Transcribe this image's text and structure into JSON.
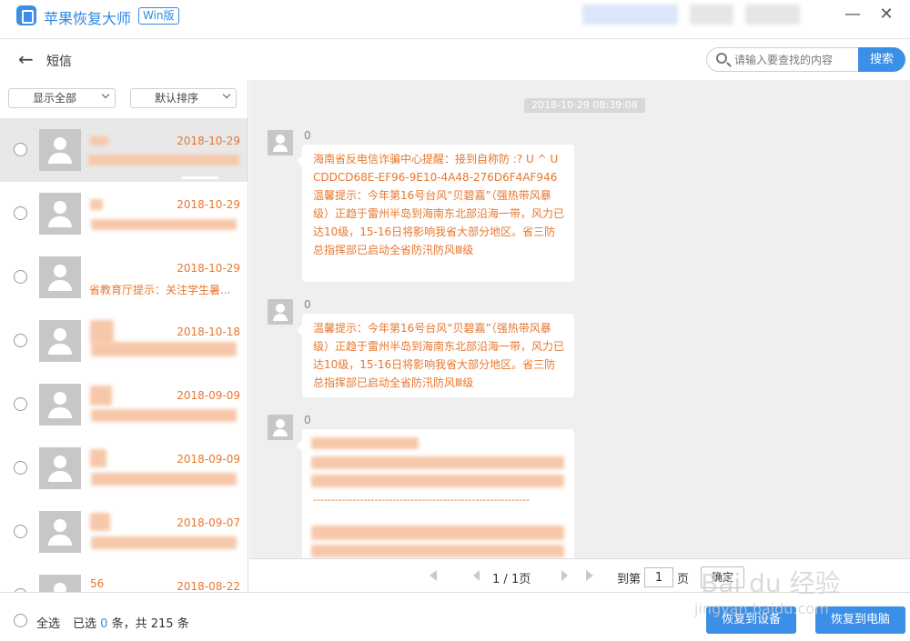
{
  "app": {
    "title": "苹果恢复大师",
    "edition_badge": "Win版"
  },
  "window": {
    "minimize_icon": "minimize-icon",
    "close_icon": "close-icon"
  },
  "nav": {
    "back_icon": "arrow-left-icon",
    "title": "短信"
  },
  "search": {
    "placeholder": "请输入要查找的内容",
    "value": "",
    "button_label": "搜索"
  },
  "filters": {
    "show": "显示全部",
    "sort": "默认排序"
  },
  "conversations": [
    {
      "name": "",
      "date": "2018-10-29",
      "preview": "",
      "selected": true
    },
    {
      "name": "",
      "date": "2018-10-29",
      "preview": "",
      "selected": false
    },
    {
      "name": "",
      "date": "2018-10-29",
      "preview": "省教育厅提示：关注学生暑...",
      "selected": false
    },
    {
      "name": "",
      "date": "2018-10-18",
      "preview": "",
      "selected": false
    },
    {
      "name": "",
      "date": "2018-09-09",
      "preview": "",
      "selected": false
    },
    {
      "name": "",
      "date": "2018-09-09",
      "preview": "",
      "selected": false
    },
    {
      "name": "",
      "date": "2018-09-07",
      "preview": "",
      "selected": false
    },
    {
      "name": "56",
      "date": "2018-08-22",
      "preview": "",
      "selected": false
    }
  ],
  "chat": {
    "timestamp": "2018-10-29 08:39:08",
    "messages": [
      {
        "sender": "0",
        "text": "海南省反电信诈骗中心提醒：接到自称防 :? U ^ U CDDCD68E-EF96-9E10-4A48-276D6F4AF946温馨提示：今年第16号台风“贝碧嘉”（强热带风暴级）正趋于雷州半岛到海南东北部沿海一带，风力已达10级，15-16日将影响我省大部分地区。省三防总指挥部已启动全省防汛防风Ⅲ级"
      },
      {
        "sender": "0",
        "text": "温馨提示：今年第16号台风“贝碧嘉”（强热带风暴级）正趋于雷州半岛到海南东北部沿海一带，风力已达10级，15-16日将影响我省大部分地区。省三防总指挥部已启动全省防汛防风Ⅲ级"
      },
      {
        "sender": "0",
        "text": "",
        "divider": "------------------------------------------------------------"
      }
    ]
  },
  "pager": {
    "current": "1",
    "total": "1",
    "page_label_suffix": "页",
    "goto_prefix": "到第",
    "goto_value": "1",
    "goto_suffix": "页",
    "confirm": "确定"
  },
  "footer": {
    "select_all": "全选",
    "selected_prefix": "已选",
    "selected_count": "0",
    "selected_mid": "条，共",
    "total_count": "215",
    "total_suffix": "条",
    "restore_device": "恢复到设备",
    "restore_pc": "恢复到电脑"
  },
  "watermark": {
    "brand": "Bai du 经验",
    "url": "jingyan.baidu.com"
  }
}
